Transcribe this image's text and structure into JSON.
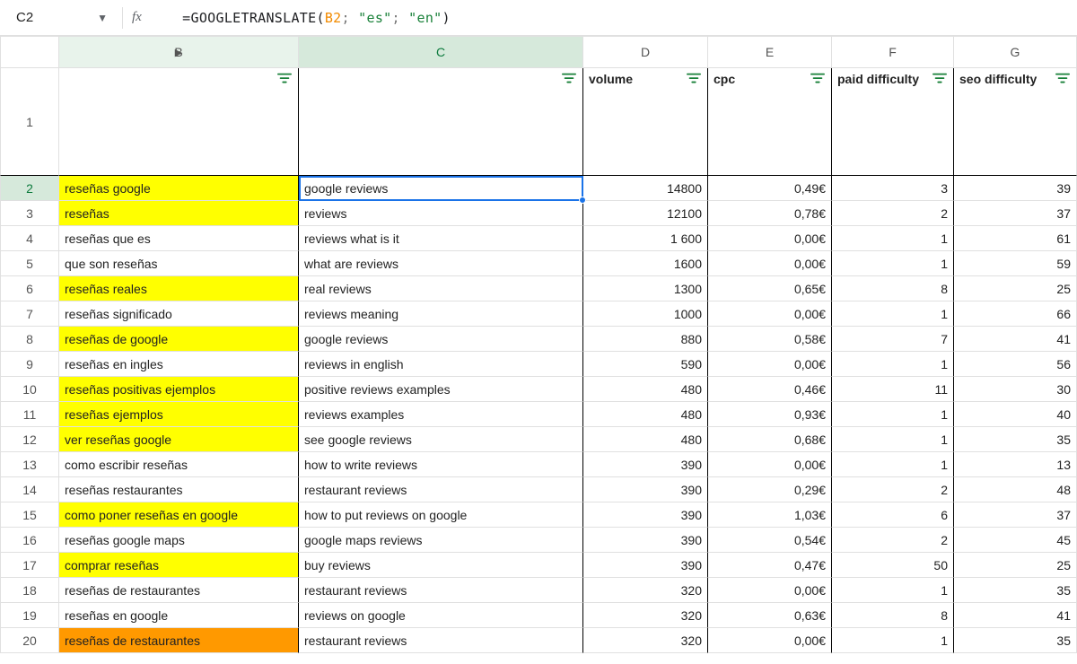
{
  "nameBox": "C2",
  "formula": {
    "func": "GOOGLETRANSLATE",
    "ref": "B2",
    "arg1": "\"es\"",
    "arg2": "\"en\""
  },
  "columns": {
    "A": "",
    "B": "B",
    "C": "C",
    "D": "D",
    "E": "E",
    "F": "F",
    "G": "G"
  },
  "headerLabels": {
    "B": "",
    "C": "",
    "D": "volume",
    "E": "cpc",
    "F": "paid difficulty",
    "G": "seo difficulty"
  },
  "rows": [
    {
      "n": 2,
      "hl": "yellow",
      "b": "reseñas google",
      "c": "google reviews",
      "d": "14800",
      "e": "0,49€",
      "f": "3",
      "g": "39"
    },
    {
      "n": 3,
      "hl": "yellow",
      "b": "reseñas",
      "c": "reviews",
      "d": "12100",
      "e": "0,78€",
      "f": "2",
      "g": "37"
    },
    {
      "n": 4,
      "hl": "",
      "b": "reseñas que es",
      "c": "reviews what is it",
      "d": "1 600",
      "e": "0,00€",
      "f": "1",
      "g": "61"
    },
    {
      "n": 5,
      "hl": "",
      "b": "que son reseñas",
      "c": "what are reviews",
      "d": "1600",
      "e": "0,00€",
      "f": "1",
      "g": "59"
    },
    {
      "n": 6,
      "hl": "yellow",
      "b": "reseñas reales",
      "c": "real reviews",
      "d": "1300",
      "e": "0,65€",
      "f": "8",
      "g": "25"
    },
    {
      "n": 7,
      "hl": "",
      "b": "reseñas significado",
      "c": "reviews meaning",
      "d": "1000",
      "e": "0,00€",
      "f": "1",
      "g": "66"
    },
    {
      "n": 8,
      "hl": "yellow",
      "b": "reseñas de google",
      "c": "google reviews",
      "d": "880",
      "e": "0,58€",
      "f": "7",
      "g": "41"
    },
    {
      "n": 9,
      "hl": "",
      "b": "reseñas en ingles",
      "c": "reviews in english",
      "d": "590",
      "e": "0,00€",
      "f": "1",
      "g": "56"
    },
    {
      "n": 10,
      "hl": "yellow",
      "b": "reseñas positivas ejemplos",
      "c": "positive reviews examples",
      "d": "480",
      "e": "0,46€",
      "f": "11",
      "g": "30"
    },
    {
      "n": 11,
      "hl": "yellow",
      "b": "reseñas ejemplos",
      "c": "reviews examples",
      "d": "480",
      "e": "0,93€",
      "f": "1",
      "g": "40"
    },
    {
      "n": 12,
      "hl": "yellow",
      "b": "ver reseñas google",
      "c": "see google reviews",
      "d": "480",
      "e": "0,68€",
      "f": "1",
      "g": "35"
    },
    {
      "n": 13,
      "hl": "",
      "b": "como escribir reseñas",
      "c": "how to write reviews",
      "d": "390",
      "e": "0,00€",
      "f": "1",
      "g": "13"
    },
    {
      "n": 14,
      "hl": "",
      "b": "reseñas restaurantes",
      "c": "restaurant reviews",
      "d": "390",
      "e": "0,29€",
      "f": "2",
      "g": "48"
    },
    {
      "n": 15,
      "hl": "yellow",
      "b": "como poner reseñas en google",
      "c": "how to put reviews on google",
      "d": "390",
      "e": "1,03€",
      "f": "6",
      "g": "37"
    },
    {
      "n": 16,
      "hl": "",
      "b": "reseñas google maps",
      "c": "google maps reviews",
      "d": "390",
      "e": "0,54€",
      "f": "2",
      "g": "45"
    },
    {
      "n": 17,
      "hl": "yellow",
      "b": "comprar reseñas",
      "c": "buy reviews",
      "d": "390",
      "e": "0,47€",
      "f": "50",
      "g": "25"
    },
    {
      "n": 18,
      "hl": "",
      "b": "reseñas de restaurantes",
      "c": "restaurant reviews",
      "d": "320",
      "e": "0,00€",
      "f": "1",
      "g": "35"
    },
    {
      "n": 19,
      "hl": "",
      "b": "reseñas en google",
      "c": "reviews on google",
      "d": "320",
      "e": "0,63€",
      "f": "8",
      "g": "41"
    },
    {
      "n": 20,
      "hl": "orange",
      "b": "reseñas de restaurantes",
      "c": "restaurant reviews",
      "d": "320",
      "e": "0,00€",
      "f": "1",
      "g": "35"
    }
  ]
}
